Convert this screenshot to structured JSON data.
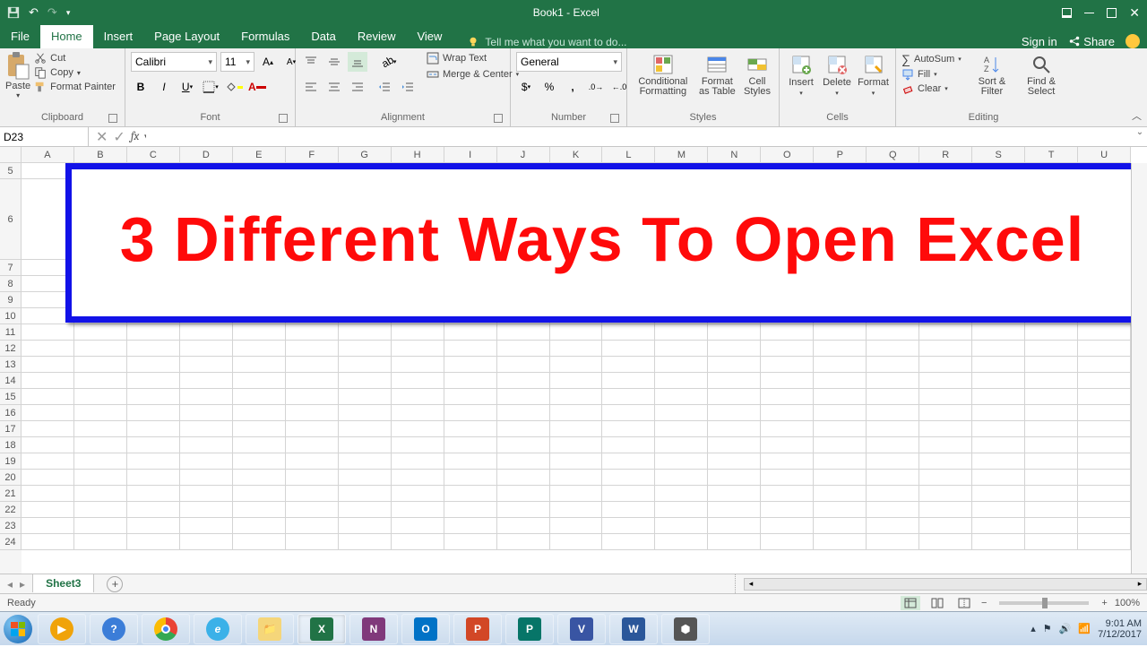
{
  "title_bar": {
    "title": "Book1 - Excel"
  },
  "tabs": {
    "file": "File",
    "items": [
      "Home",
      "Insert",
      "Page Layout",
      "Formulas",
      "Data",
      "Review",
      "View"
    ],
    "active": "Home",
    "tell_me": "Tell me what you want to do...",
    "sign_in": "Sign in",
    "share": "Share"
  },
  "ribbon": {
    "clipboard": {
      "paste": "Paste",
      "cut": "Cut",
      "copy": "Copy",
      "fmt": "Format Painter",
      "label": "Clipboard"
    },
    "font": {
      "name": "Calibri",
      "size": "11",
      "label": "Font"
    },
    "alignment": {
      "wrap": "Wrap Text",
      "merge": "Merge & Center",
      "label": "Alignment"
    },
    "number": {
      "format": "General",
      "label": "Number"
    },
    "styles": {
      "cond": "Conditional Formatting",
      "fmt_table": "Format as Table",
      "cell_styles": "Cell Styles",
      "label": "Styles"
    },
    "cells": {
      "insert": "Insert",
      "delete": "Delete",
      "format": "Format",
      "label": "Cells"
    },
    "editing": {
      "autosum": "AutoSum",
      "fill": "Fill",
      "clear": "Clear",
      "sort": "Sort & Filter",
      "find": "Find & Select",
      "label": "Editing"
    }
  },
  "fx": {
    "name_box": "D23"
  },
  "grid": {
    "columns": [
      "A",
      "B",
      "C",
      "D",
      "E",
      "F",
      "G",
      "H",
      "I",
      "J",
      "K",
      "L",
      "M",
      "N",
      "O",
      "P",
      "Q",
      "R",
      "S",
      "T",
      "U"
    ],
    "first_row": 5,
    "banner_text": "3 Different Ways To Open Excel"
  },
  "sheets": {
    "active": "Sheet3"
  },
  "status": {
    "ready": "Ready",
    "zoom": "100%"
  },
  "taskbar": {
    "time": "9:01 AM",
    "date": "7/12/2017"
  }
}
